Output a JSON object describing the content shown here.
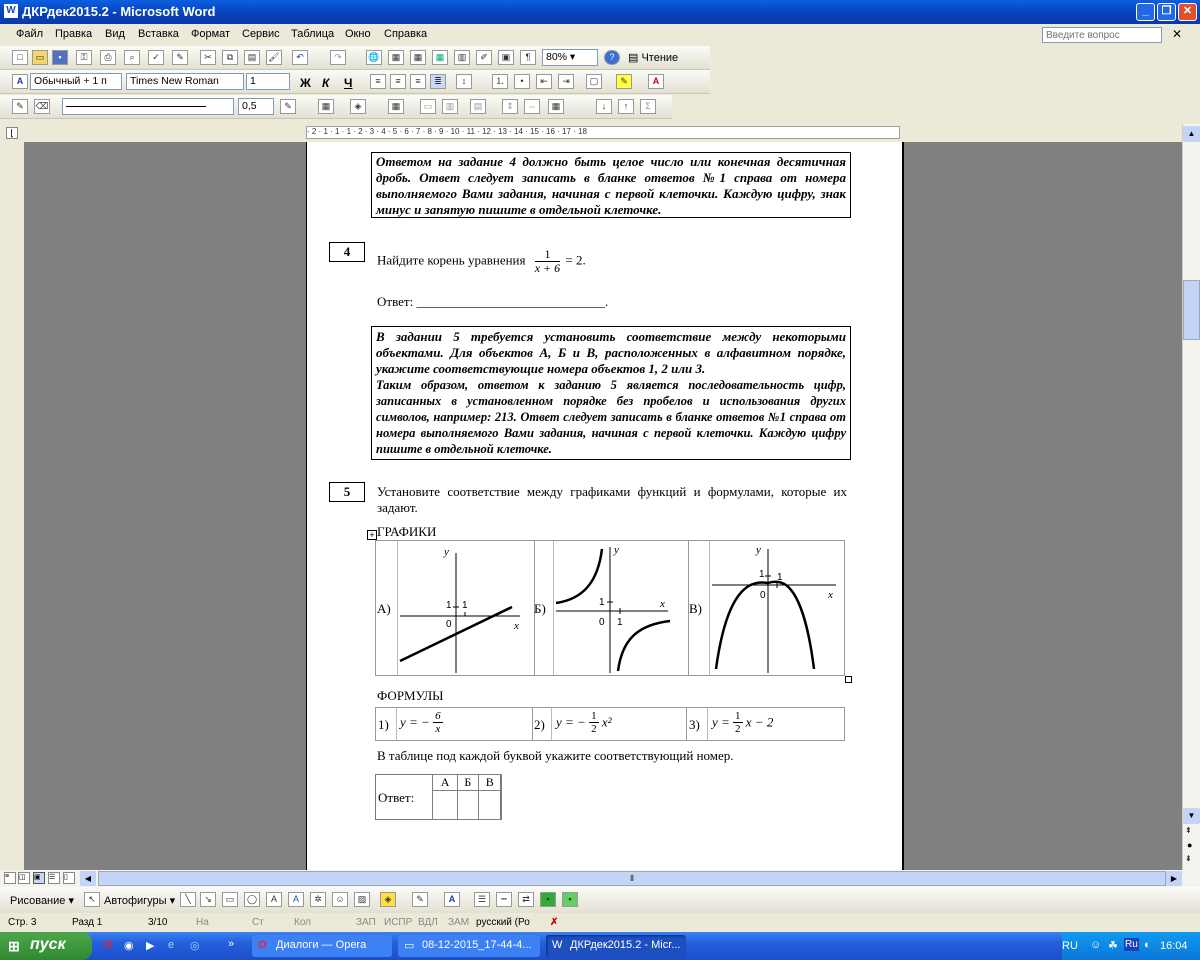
{
  "window": {
    "title": "ДКРдек2015.2 - Microsoft Word",
    "help_placeholder": "Введите вопрос"
  },
  "menu": [
    "Файл",
    "Правка",
    "Вид",
    "Вставка",
    "Формат",
    "Сервис",
    "Таблица",
    "Окно",
    "Справка"
  ],
  "toolbar": {
    "zoom": "80%",
    "read_label": "Чтение",
    "style": "Обычный + 1 п",
    "font": "Times New Roman",
    "size": "1",
    "bold": "Ж",
    "italic": "К",
    "underline": "Ч",
    "line_width": "0,5"
  },
  "ruler_text": "· 2 · 1 · 1 · 1 · 2 · 3 · 4 · 5 · 6 · 7 · 8 · 9 · 10 · 11 · 12 · 13 · 14 · 15 · 16 · 17 · 18",
  "doc": {
    "instr1": "Ответом на задание 4 должно быть целое число или конечная десятичная дробь. Ответ следует записать в бланке ответов №1 справа от номера выполняемого Вами задания, начиная с первой клеточки. Каждую цифру, знак минус и запятую пишите в отдельной клеточке.",
    "task4_num": "4",
    "task4_text": "Найдите корень уравнения",
    "task4_frac_num": "1",
    "task4_frac_den": "x + 6",
    "task4_rhs": "= 2.",
    "answer_label": "Ответ: ",
    "answer_line": "_____________________________.",
    "instr2a": "В задании 5 требуется установить соответствие между некоторыми объектами. Для объектов А, Б и В, расположенных в алфавитном порядке, укажите соответствующие номера объектов 1, 2 или 3.",
    "instr2b": "Таким образом, ответом к заданию 5 является последовательность цифр, записанных в установленном порядке без пробелов и использования других символов, например: 213. Ответ следует записать в бланке ответов №1 справа от номера выполняемого Вами задания, начиная с первой клеточки. Каждую цифру пишите в отдельной клеточке.",
    "task5_num": "5",
    "task5_text": "Установите соответствие между графиками функций и формулами, которые их задают.",
    "graphs_title": "ГРАФИКИ",
    "graph_labels": [
      "А)",
      "Б)",
      "В)"
    ],
    "axis_y": "y",
    "axis_x": "x",
    "one": "1",
    "zero": "0",
    "formulas_title": "ФОРМУЛЫ",
    "formulas": [
      {
        "n": "1)",
        "pre": "y = −",
        "num": "6",
        "den": "x",
        "post": ""
      },
      {
        "n": "2)",
        "pre": "y = −",
        "num": "1",
        "den": "2",
        "post": "x²"
      },
      {
        "n": "3)",
        "pre": "y =",
        "num": "1",
        "den": "2",
        "post": "x − 2"
      }
    ],
    "table_instr": "В таблице под каждой буквой укажите соответствующий номер.",
    "answer_table_label": "Ответ:",
    "answer_cols": [
      "А",
      "Б",
      "В"
    ]
  },
  "drawbar": {
    "draw": "Рисование",
    "autoshapes": "Автофигуры"
  },
  "status": {
    "page": "Стр. 3",
    "section": "Разд 1",
    "pages": "3/10",
    "at": "На",
    "ln": "Ст",
    "col": "Кол",
    "rec": "ЗАП",
    "trk": "ИСПР",
    "ext": "ВДЛ",
    "ovr": "ЗАМ",
    "lang": "русский (Ро"
  },
  "taskbar": {
    "start": "пуск",
    "tasks": [
      "Диалоги — Opera",
      "08-12-2015_17-44-4...",
      "ДКРдек2015.2 - Micr..."
    ],
    "lang": "RU",
    "time": "16:04"
  }
}
